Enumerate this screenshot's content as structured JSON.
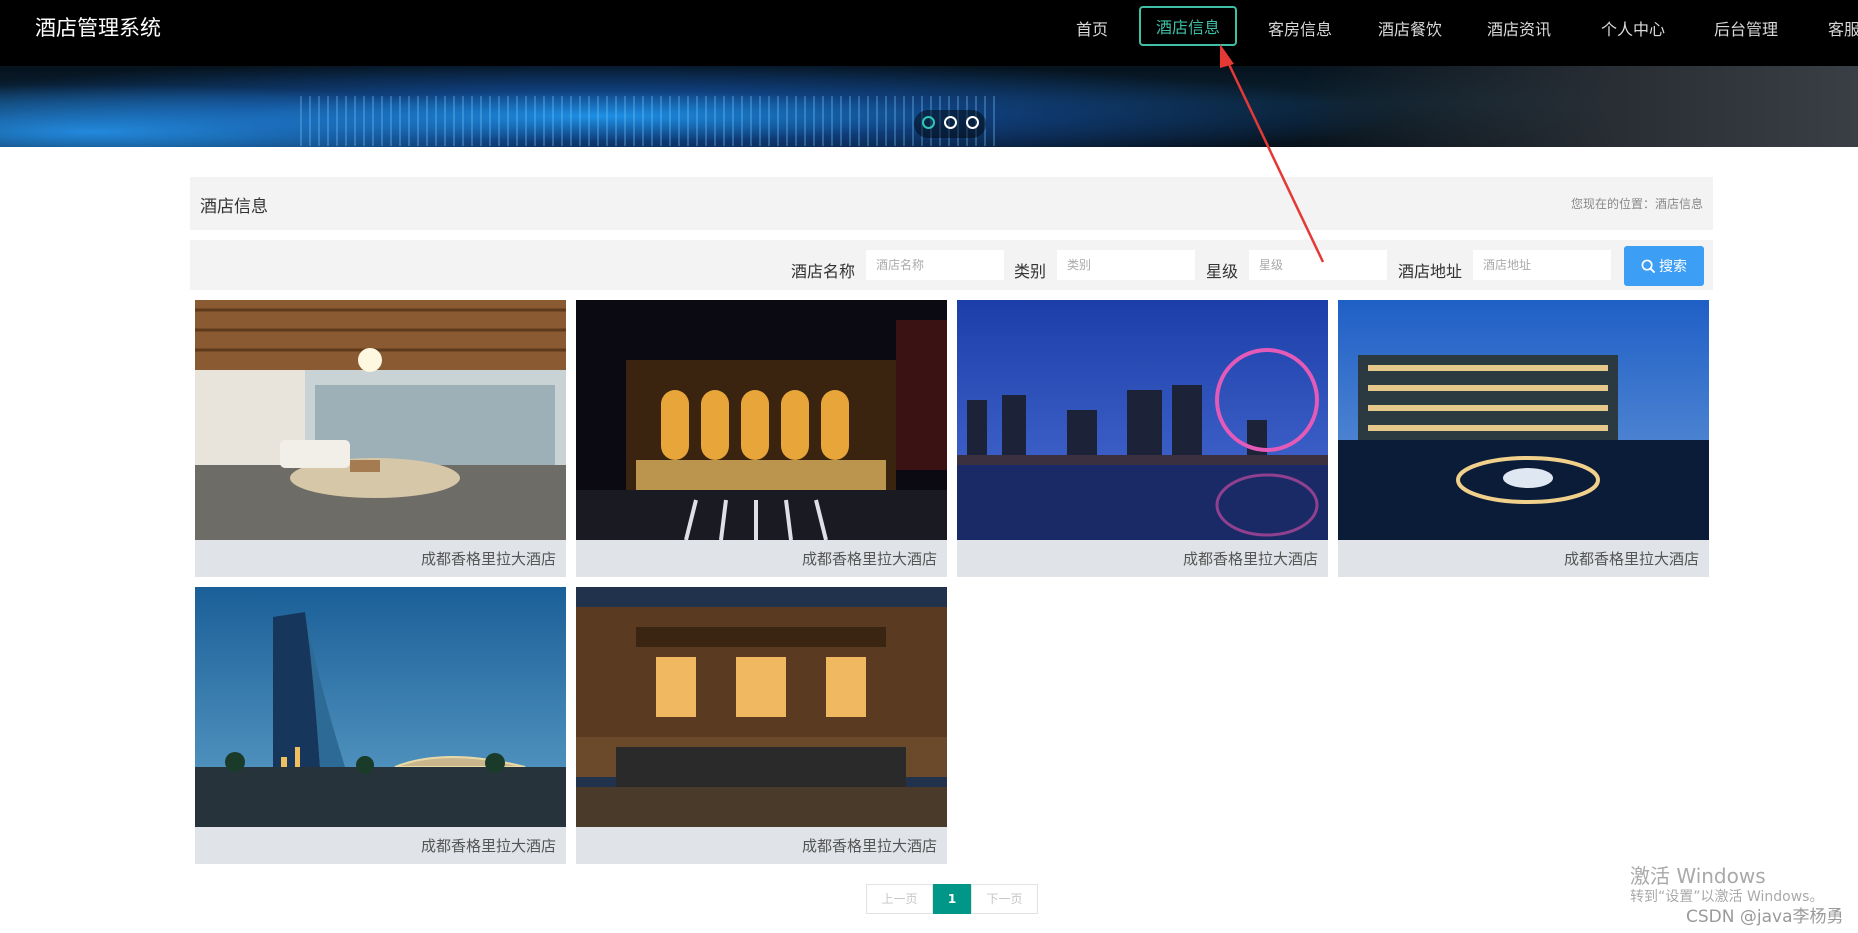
{
  "app": {
    "title": "酒店管理系统"
  },
  "nav": {
    "items": [
      {
        "label": "首页"
      },
      {
        "label": "酒店信息"
      },
      {
        "label": "客房信息"
      },
      {
        "label": "酒店餐饮"
      },
      {
        "label": "酒店资讯"
      },
      {
        "label": "个人中心"
      },
      {
        "label": "后台管理"
      },
      {
        "label": "客服"
      }
    ],
    "active_index": 1,
    "active_color": "#3fbfa5"
  },
  "carousel": {
    "slide_count": 3,
    "active_index": 0
  },
  "section": {
    "title": "酒店信息",
    "breadcrumb": "您现在的位置：酒店信息"
  },
  "search": {
    "name_label": "酒店名称",
    "name_placeholder": "酒店名称",
    "type_label": "类别",
    "type_placeholder": "类别",
    "star_label": "星级",
    "star_placeholder": "星级",
    "address_label": "酒店地址",
    "address_placeholder": "酒店地址",
    "button_label": "搜索",
    "button_color": "#3d9ef5"
  },
  "hotels": [
    {
      "name": "成都香格里拉大酒店"
    },
    {
      "name": "成都香格里拉大酒店"
    },
    {
      "name": "成都香格里拉大酒店"
    },
    {
      "name": "成都香格里拉大酒店"
    },
    {
      "name": "成都香格里拉大酒店"
    },
    {
      "name": "成都香格里拉大酒店"
    }
  ],
  "pagination": {
    "prev": "上一页",
    "current": "1",
    "next": "下一页",
    "accent": "#009688"
  },
  "watermark": {
    "line1": "激活 Windows",
    "line2": "转到“设置”以激活 Windows。",
    "credit": "CSDN @java李杨勇"
  }
}
